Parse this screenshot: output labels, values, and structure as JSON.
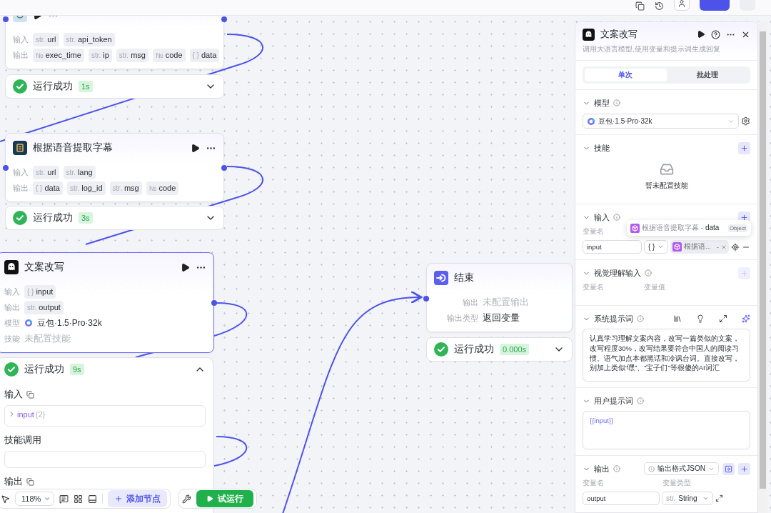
{
  "canvas": {
    "nodes": [
      {
        "kind": "plugin",
        "selected": false,
        "rows": [
          {
            "kind": "tags",
            "label": "输入",
            "tags": [
              {
                "prefix": "str.",
                "name": "url"
              },
              {
                "prefix": "str.",
                "name": "api_token"
              }
            ]
          },
          {
            "kind": "tags",
            "label": "输出",
            "tags": [
              {
                "prefix": "№",
                "name": "exec_time"
              },
              {
                "prefix": "str.",
                "name": "ip"
              },
              {
                "prefix": "str.",
                "name": "msg"
              },
              {
                "prefix": "№",
                "name": "code"
              },
              {
                "prefix": "{ }",
                "name": "data"
              }
            ]
          }
        ],
        "status": {
          "label": "运行成功",
          "time": "1s",
          "expanded": false
        }
      },
      {
        "kind": "plugin",
        "title": "根据语音提取字幕",
        "selected": false,
        "rows": [
          {
            "kind": "tags",
            "label": "输入",
            "tags": [
              {
                "prefix": "str.",
                "name": "url"
              },
              {
                "prefix": "str.",
                "name": "lang"
              }
            ]
          },
          {
            "kind": "tags",
            "label": "输出",
            "tags": [
              {
                "prefix": "{ }",
                "name": "data"
              },
              {
                "prefix": "str.",
                "name": "log_id"
              },
              {
                "prefix": "str.",
                "name": "msg"
              },
              {
                "prefix": "№",
                "name": "code"
              }
            ]
          }
        ],
        "status": {
          "label": "运行成功",
          "time": "3s",
          "expanded": false
        }
      },
      {
        "kind": "llm",
        "title": "文案改写",
        "selected": true,
        "rows": [
          {
            "kind": "tags",
            "label": "输入",
            "tags": [
              {
                "prefix": "{ }",
                "name": "input"
              }
            ]
          },
          {
            "kind": "tags",
            "label": "输出",
            "tags": [
              {
                "prefix": "str.",
                "name": "output"
              }
            ]
          },
          {
            "kind": "model",
            "label": "模型",
            "value": "豆包·1.5·Pro·32k"
          },
          {
            "kind": "text",
            "label": "技能",
            "value": "未配置技能",
            "muted": true
          }
        ],
        "status": {
          "label": "运行成功",
          "time": "9s",
          "expanded": true,
          "sections": [
            {
              "kind": "tree",
              "title": "输入",
              "key": "input",
              "count": "{2}"
            },
            {
              "kind": "empty",
              "title": "技能调用"
            },
            {
              "kind": "heading",
              "title": "输出"
            }
          ]
        }
      },
      {
        "kind": "end",
        "title": "结束",
        "selected": false,
        "rows": [
          {
            "kind": "text",
            "label": "输出",
            "value": "未配置输出",
            "muted": true
          },
          {
            "kind": "text",
            "label": "输出类型",
            "value": "返回变量",
            "muted": false
          }
        ],
        "status": {
          "label": "运行成功",
          "time": "0.000s",
          "expanded": false
        }
      }
    ]
  },
  "toolbar": {
    "zoom": "118%",
    "add_node": "添加节点",
    "run": "试运行"
  },
  "panel": {
    "title": "文案改写",
    "description": "调用大语言模型,使用变量和提示词生成回复",
    "tabs": [
      {
        "label": "单次",
        "selected": true
      },
      {
        "label": "批处理",
        "selected": false
      }
    ],
    "sections": [
      {
        "kind": "model",
        "title": "模型",
        "expanded": true,
        "model": "豆包·1.5·Pro·32k"
      },
      {
        "kind": "skills",
        "title": "技能",
        "expanded": true,
        "empty_text": "暂未配置技能"
      },
      {
        "kind": "inputs",
        "title": "输入",
        "expanded": true,
        "columns": [
          "变量名"
        ],
        "rows": [
          {
            "name": "input",
            "type": "{ }",
            "ref": "根据语...",
            "ref_sep": "-"
          }
        ],
        "tooltip": {
          "text": "根据语音提取字幕 - **data**",
          "badge": "Object"
        }
      },
      {
        "kind": "vision",
        "title": "视觉理解输入",
        "expanded": true,
        "add_disabled": true,
        "columns": [
          "变量名",
          "变量值"
        ]
      },
      {
        "kind": "system",
        "title": "系统提示词",
        "expanded": true,
        "text": "认真学习理解文案内容，改写一篇类似的文案，改写程度30%，改写结果要符合中国人的阅读习惯。语气加点本都黑话和冷讽台词。直接改写，别加上类似“嘿”、“宝子们”等很傻的AI词汇"
      },
      {
        "kind": "user",
        "title": "用户提示词",
        "expanded": true,
        "text": "{{input}}"
      },
      {
        "kind": "outputs",
        "title": "输出",
        "expanded": true,
        "format": "输出格式JSON",
        "columns": [
          "变量名",
          "变量类型"
        ],
        "rows": [
          {
            "name": "output",
            "type_prefix": "str.",
            "type": "String"
          }
        ]
      }
    ]
  }
}
